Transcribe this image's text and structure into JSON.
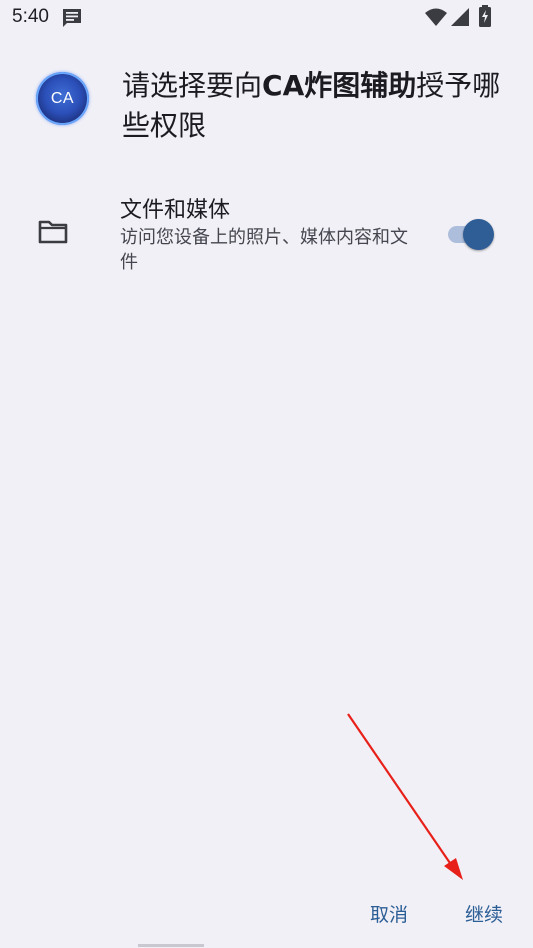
{
  "status_bar": {
    "time": "5:40",
    "icons": [
      "message-icon",
      "wifi-icon",
      "signal-icon",
      "battery-charging-icon"
    ]
  },
  "dialog": {
    "app_icon_label": "CA",
    "title_prefix": "请选择要向",
    "app_name": "CA炸图辅助",
    "title_suffix": "授予哪些权限"
  },
  "permission": {
    "icon": "folder-icon",
    "title": "文件和媒体",
    "description": "访问您设备上的照片、媒体内容和文件",
    "enabled": true
  },
  "buttons": {
    "cancel": "取消",
    "continue": "继续"
  },
  "colors": {
    "background": "#f1f0f6",
    "accent": "#2c5e96",
    "toggle_thumb": "#2f5d96",
    "toggle_track": "#adbedc",
    "annotation_arrow": "#e8201a"
  }
}
